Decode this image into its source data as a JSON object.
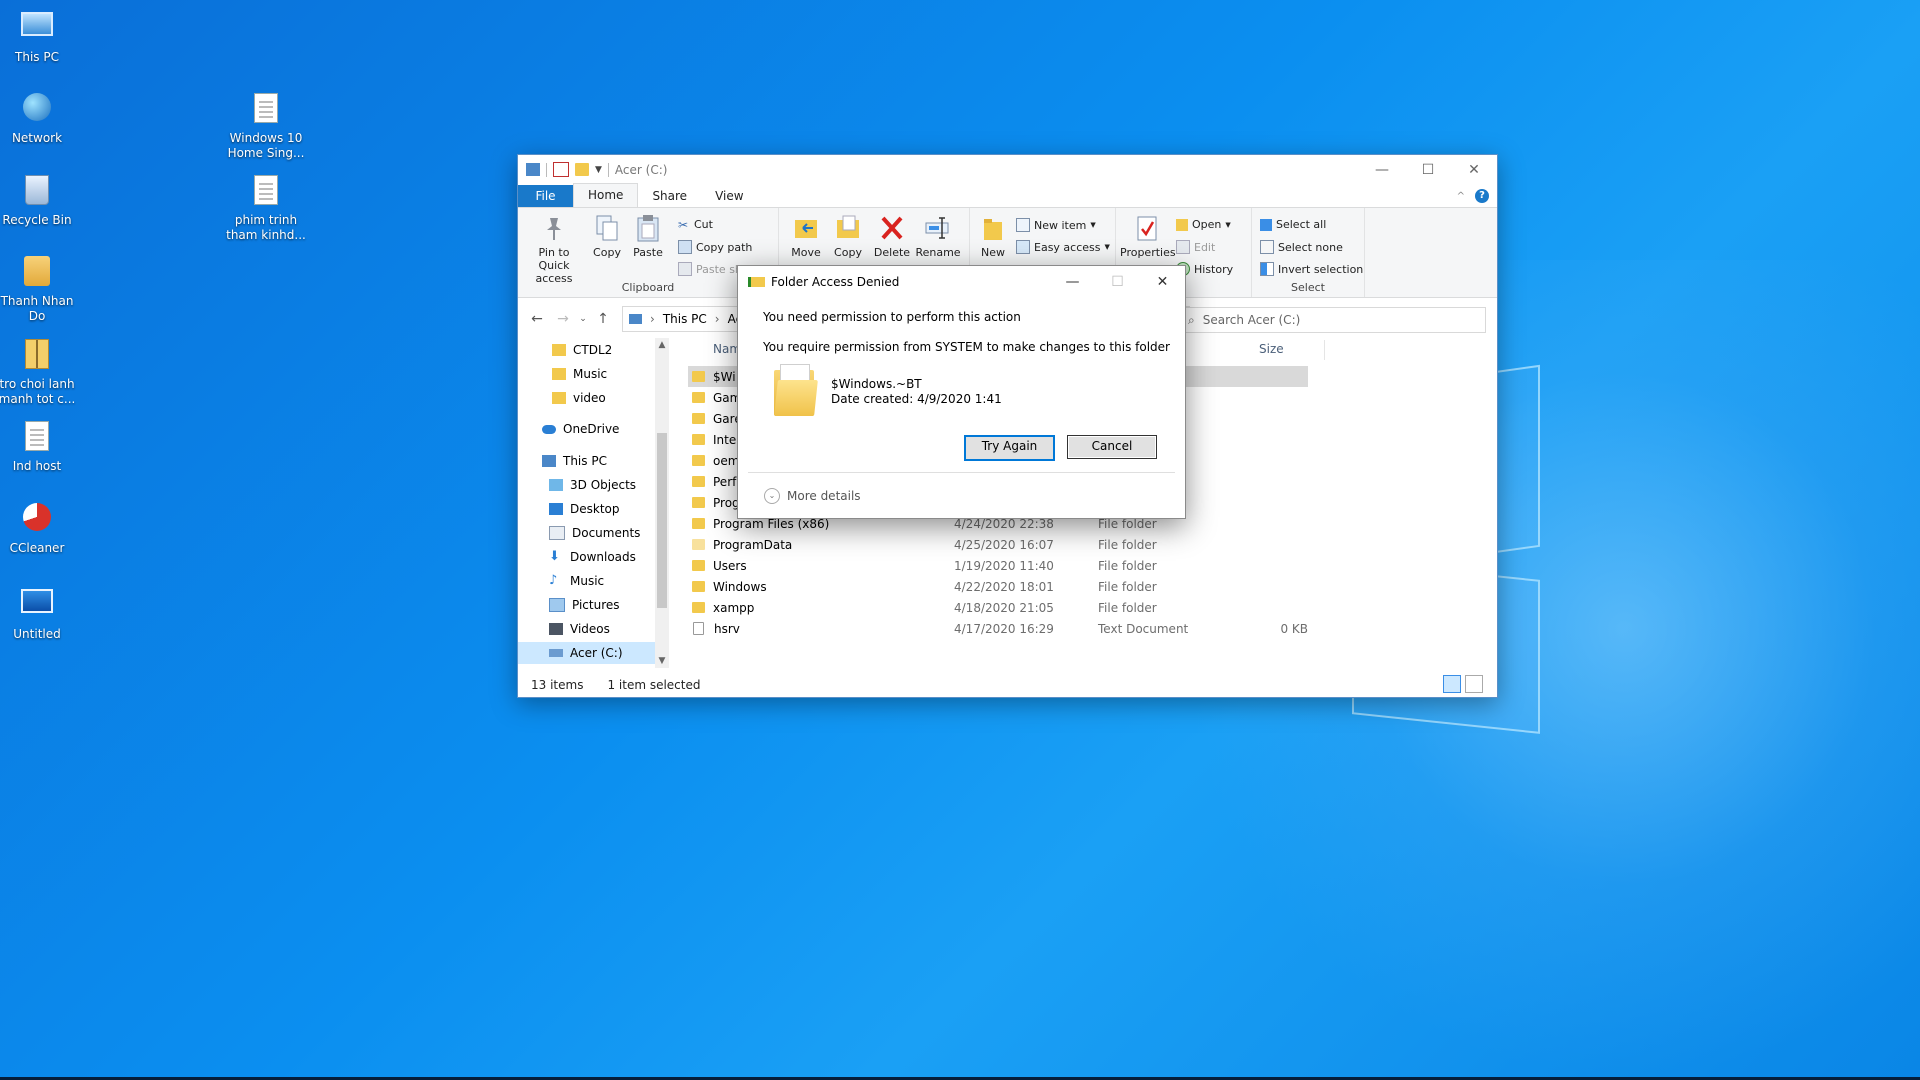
{
  "desktop": {
    "icons": [
      {
        "label": "This PC"
      },
      {
        "label": "Network"
      },
      {
        "label": "Recycle Bin"
      },
      {
        "label": "Thanh Nhan Do"
      },
      {
        "label": "tro choi lanh manh tot c..."
      },
      {
        "label": "Ind host"
      },
      {
        "label": "CCleaner"
      },
      {
        "label": "Untitled"
      },
      {
        "label": "Windows 10 Home Sing..."
      },
      {
        "label": "phim trinh tham kinhd..."
      }
    ],
    "colors": {
      "wallpaper": "#0b8ff0"
    }
  },
  "explorer": {
    "title": "Acer (C:)",
    "tabs": {
      "file": "File",
      "home": "Home",
      "share": "Share",
      "view": "View"
    },
    "ribbon": {
      "clipboard": {
        "pin": "Pin to Quick access",
        "copy": "Copy",
        "paste": "Paste",
        "cut": "Cut",
        "copy_path": "Copy path",
        "paste_shortcut": "Paste shortcut",
        "group": "Clipboard"
      },
      "organize": {
        "move": "Move",
        "copy": "Copy",
        "delete": "Delete",
        "rename": "Rename"
      },
      "new": {
        "new": "New",
        "new_item": "New item",
        "easy_access": "Easy access"
      },
      "open": {
        "properties": "Properties",
        "open": "Open",
        "edit": "Edit",
        "history": "History",
        "group_partial": "en"
      },
      "select": {
        "select_all": "Select all",
        "select_none": "Select none",
        "invert": "Invert selection",
        "group": "Select"
      }
    },
    "address": {
      "this_pc": "This PC",
      "current_partial": "Ac"
    },
    "search_placeholder": "Search Acer (C:)",
    "nav": {
      "ctdl2": "CTDL2",
      "music_top": "Music",
      "video": "video",
      "onedrive": "OneDrive",
      "this_pc": "This PC",
      "objects3d": "3D Objects",
      "desktop": "Desktop",
      "documents": "Documents",
      "downloads": "Downloads",
      "music": "Music",
      "pictures": "Pictures",
      "videos": "Videos",
      "acer": "Acer (C:)"
    },
    "columns": {
      "name": "Name",
      "size": "Size"
    },
    "files": [
      {
        "name": "$Wi",
        "date": "",
        "type": "",
        "size": ""
      },
      {
        "name": "Gam",
        "date": "",
        "type": "",
        "size": ""
      },
      {
        "name": "Gare",
        "date": "",
        "type": "",
        "size": ""
      },
      {
        "name": "Inte",
        "date": "",
        "type": "",
        "size": ""
      },
      {
        "name": "oem",
        "date": "",
        "type": "",
        "size": ""
      },
      {
        "name": "Perf",
        "date": "",
        "type": "",
        "size": ""
      },
      {
        "name": "Prog",
        "date": "",
        "type": "",
        "size": ""
      },
      {
        "name": "Program Files (x86)",
        "date": "4/24/2020 22:38",
        "type": "File folder",
        "size": ""
      },
      {
        "name": "ProgramData",
        "date": "4/25/2020 16:07",
        "type": "File folder",
        "size": ""
      },
      {
        "name": "Users",
        "date": "1/19/2020 11:40",
        "type": "File folder",
        "size": ""
      },
      {
        "name": "Windows",
        "date": "4/22/2020 18:01",
        "type": "File folder",
        "size": ""
      },
      {
        "name": "xampp",
        "date": "4/18/2020 21:05",
        "type": "File folder",
        "size": ""
      },
      {
        "name": "hsrv",
        "date": "4/17/2020 16:29",
        "type": "Text Document",
        "size": "0 KB"
      }
    ],
    "status": {
      "items": "13 items",
      "selected": "1 item selected"
    }
  },
  "dialog": {
    "title": "Folder Access Denied",
    "line1": "You need permission to perform this action",
    "line2": "You require permission from SYSTEM to make changes to this folder",
    "folder_name": "$Windows.~BT",
    "date_created": "Date created: 4/9/2020 1:41",
    "try_again": "Try Again",
    "cancel": "Cancel",
    "more_details": "More details"
  }
}
